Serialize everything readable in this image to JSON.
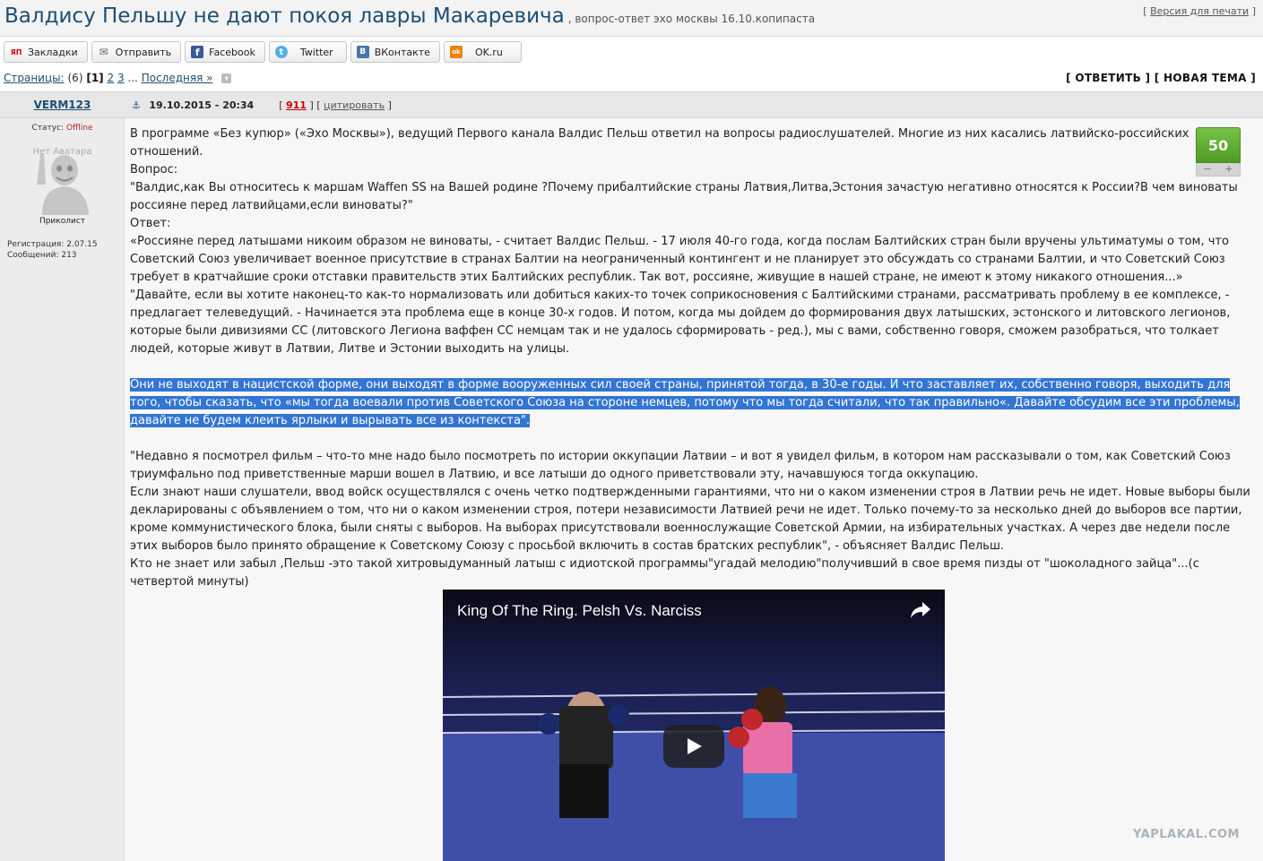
{
  "topic": {
    "title": "Валдису Пельшу не дают покоя лавры Макаревича",
    "subtitle": ", вопрос-ответ эхо москвы 16.10.копипаста",
    "print_left": "[ ",
    "print_link": "Версия для печати",
    "print_right": " ]"
  },
  "share": [
    {
      "icon": "yandex-icon",
      "icon_text": "ЯП",
      "label": "Закладки",
      "color": "#ffffff",
      "fg": "#d00"
    },
    {
      "icon": "mail-icon",
      "icon_text": "✉",
      "label": "Отправить",
      "color": "#ffffff",
      "fg": "#666"
    },
    {
      "icon": "facebook-icon",
      "icon_text": "f",
      "label": "Facebook",
      "color": "#3b5998",
      "fg": "#fff"
    },
    {
      "icon": "twitter-icon",
      "icon_text": "t",
      "label": "Twitter",
      "color": "#55acee",
      "fg": "#fff"
    },
    {
      "icon": "vk-icon",
      "icon_text": "B",
      "label": "ВКонтакте",
      "color": "#4a76a8",
      "fg": "#fff"
    },
    {
      "icon": "ok-icon",
      "icon_text": "ok",
      "label": "OK.ru",
      "color": "#ee8208",
      "fg": "#fff"
    }
  ],
  "pager": {
    "label": "Страницы:",
    "count": "(6)",
    "current": "[1]",
    "page2": "2",
    "page3": "3",
    "ellipsis": "...",
    "last": "Последняя »"
  },
  "actions": {
    "reply": "[ ОТВЕТИТЬ ]",
    "new_topic": "[ НОВАЯ ТЕМА ]"
  },
  "post": {
    "author": "VERM123",
    "status_label": "Статус: ",
    "status_value": "Offline",
    "avatar_caption": "Нет Аватара",
    "rank": "Приколист",
    "registration": "Регистрация: 2.07.15",
    "messages": "Сообщений: 213",
    "date": "19.10.2015 - 20:34",
    "number_left": "[ ",
    "number": "911",
    "number_right": " ]",
    "quote_left": "[ ",
    "quote": "цитировать",
    "quote_right": " ]",
    "rating": "50",
    "rating_minus": "−",
    "rating_plus": "+",
    "p1": "В программе «Без купюр» («Эхо Москвы»), ведущий Первого канала Валдис Пельш ответил на вопросы радиослушателей. Многие из них касались латвийско-российских отношений.",
    "p2": "Вопрос:",
    "p3": "\"Валдис,как Вы относитесь к маршам Waffen SS на Вашей родине ?Почему прибалтийские страны Латвия,Литва,Эстония зачастую негативно относятся к России?В чем виноваты россияне перед латвийцами,если виноваты?\"",
    "p4": "Ответ:",
    "p5": "«Россияне перед латышами никоим образом не виноваты, - считает Валдис Пельш. - 17 июля 40-го года, когда послам Балтийских стран были вручены ультиматумы о том, что Советский Союз увеличивает военное присутствие в странах Балтии на неограниченный контингент и не планирует это обсуждать со странами Балтии, и что Советский Союз требует в кратчайшие сроки отставки правительств этих Балтийских республик. Так вот, россияне, живущие в нашей стране, не имеют к этому никакого отношения...»",
    "p6": "\"Давайте, если вы хотите наконец-то как-то нормализовать или добиться каких-то точек соприкосновения с Балтийскими странами, рассматривать проблему в ее комплексе, - предлагает телеведущий. - Начинается эта проблема еще в конце 30-х годов. И потом, когда мы дойдем до формирования двух латышских, эстонского и литовского легионов, которые были дивизиями СС (литовского Легиона ваффен СС немцам так и не удалось сформировать - ред.), мы с вами, собственно говоря, сможем разобраться, что толкает людей, которые живут в Латвии, Литве и Эстонии выходить на улицы.",
    "p7": "Они не выходят в нацистской форме, они выходят в форме вооруженных сил своей страны, принятой тогда, в 30-е годы. И что заставляет их, собственно говоря, выходить для того, чтобы сказать, что «мы тогда воевали против Советского Союза на стороне немцев, потому что мы тогда считали, что так правильно«. Давайте обсудим все эти проблемы, давайте не будем клеить ярлыки и вырывать все из контекста\".",
    "p8": "\"Недавно я посмотрел фильм – что-то мне надо было посмотреть по истории оккупации Латвии – и вот я увидел фильм, в котором нам рассказывали о том, как Советский Союз триумфально под приветственные марши вошел в Латвию, и все латыши до одного приветствовали эту, начавшуюся тогда оккупацию.",
    "p9": "Если знают наши слушатели, ввод войск осуществлялся с очень четко подтвержденными гарантиями, что ни о каком изменении строя в Латвии речь не идет. Новые выборы были декларированы с объявлением о том, что ни о каком изменении строя, потери независимости Латвией речи не идет. Только почему-то за несколько дней до выборов все партии, кроме коммунистического блока, были сняты с выборов. На выборах присутствовали военнослужащие Советской Армии, на избирательных участках. А через две недели после этих выборов было принято обращение к Советскому Союзу с просьбой включить в состав братских республик\", - объясняет Валдис Пельш.",
    "p10": "Кто не знает или забыл ,Пельш -это такой хитровыдуманный латыш с идиотской программы\"угадай мелодию\"получивший в свое время пизды от \"шоколадного зайца\"...(с четвертой минуты)"
  },
  "video": {
    "title": "King Of The Ring. Pelsh Vs. Narciss"
  },
  "watermark": "YAPLAKAL.COM"
}
